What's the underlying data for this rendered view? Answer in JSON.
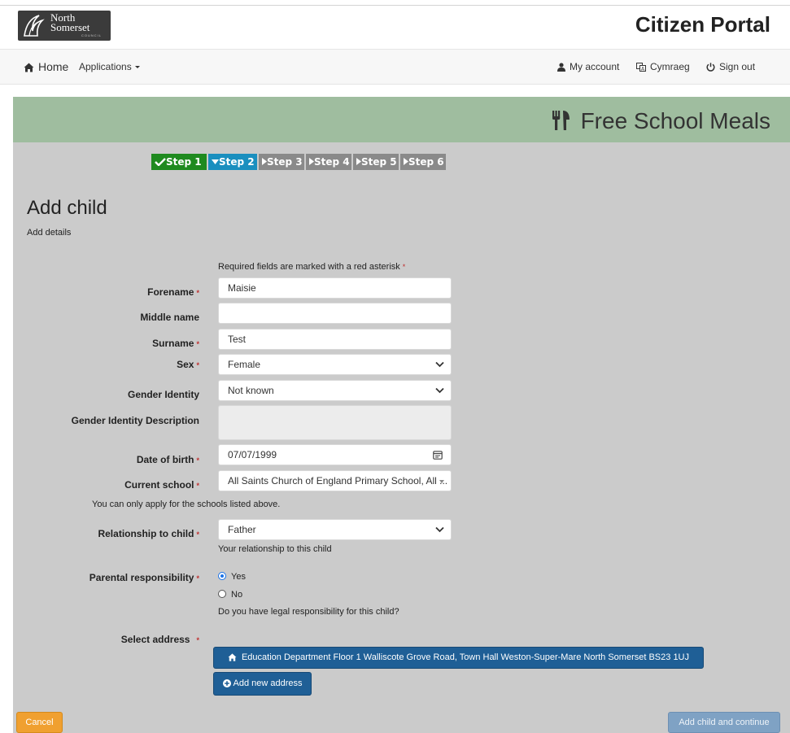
{
  "header": {
    "logo_line1": "North",
    "logo_line2": "Somerset",
    "logo_line3": "COUNCIL",
    "portal_title": "Citizen Portal"
  },
  "nav": {
    "home": "Home",
    "applications": "Applications",
    "my_account": "My account",
    "cymraeg": "Cymraeg",
    "sign_out": "Sign out"
  },
  "banner": {
    "title": "Free School Meals"
  },
  "steps": [
    {
      "label": "Step 1",
      "state": "complete"
    },
    {
      "label": "Step 2",
      "state": "current"
    },
    {
      "label": "Step 3",
      "state": "pending"
    },
    {
      "label": "Step 4",
      "state": "pending"
    },
    {
      "label": "Step 5",
      "state": "pending"
    },
    {
      "label": "Step 6",
      "state": "pending"
    }
  ],
  "page": {
    "title": "Add child",
    "subtitle": "Add details",
    "required_note": "Required fields are marked with a red asterisk"
  },
  "form": {
    "forename": {
      "label": "Forename",
      "value": "Maisie"
    },
    "middle_name": {
      "label": "Middle name",
      "value": ""
    },
    "surname": {
      "label": "Surname",
      "value": "Test"
    },
    "sex": {
      "label": "Sex",
      "value": "Female"
    },
    "gender_identity": {
      "label": "Gender Identity",
      "value": "Not known"
    },
    "gender_identity_description": {
      "label": "Gender Identity Description",
      "value": ""
    },
    "date_of_birth": {
      "label": "Date of birth",
      "value": "07/07/1999"
    },
    "current_school": {
      "label": "Current school",
      "value": "All Saints Church of England Primary School, All ...",
      "help": "You can only apply for the schools listed above."
    },
    "relationship": {
      "label": "Relationship to child",
      "value": "Father",
      "help": "Your relationship to this child"
    },
    "parental_responsibility": {
      "label": "Parental responsibility",
      "options": [
        "Yes",
        "No"
      ],
      "selected": "Yes",
      "help": "Do you have legal responsibility for this child?"
    },
    "select_address": {
      "label": "Select address",
      "address": "Education Department Floor 1 Walliscote Grove Road, Town Hall Weston-Super-Mare North Somerset BS23 1UJ",
      "add_new": "Add new address"
    }
  },
  "actions": {
    "cancel": "Cancel",
    "continue": "Add child and continue"
  },
  "colors": {
    "banner": "#9fbd9f",
    "step_complete": "#1f8a1f",
    "step_current": "#1a8fbf",
    "step_pending": "#8a8a8a",
    "primary_button": "#1f5f96",
    "cancel_button": "#f0a030",
    "required_asterisk": "#c03030"
  }
}
